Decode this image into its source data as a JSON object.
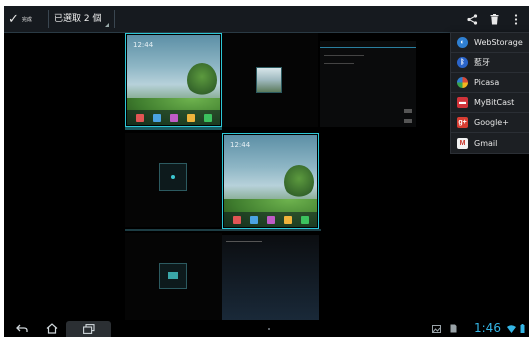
{
  "action_bar": {
    "done_label": "完成",
    "selection_label": "已選取 2 個",
    "share_icon": "share-icon",
    "delete_icon": "trash-icon",
    "overflow_icon": "overflow-menu-icon"
  },
  "share_menu": {
    "items": [
      {
        "label": "WebStorage",
        "icon": "webstorage-icon",
        "color": "#2f7fd1"
      },
      {
        "label": "藍牙",
        "icon": "bluetooth-icon",
        "color": "#2a64c8"
      },
      {
        "label": "Picasa",
        "icon": "picasa-icon",
        "color": "#d64a3a"
      },
      {
        "label": "MyBitCast",
        "icon": "mybitcast-icon",
        "color": "#d1333a"
      },
      {
        "label": "Google+",
        "icon": "google-plus-icon",
        "color": "#d73d32"
      },
      {
        "label": "Gmail",
        "icon": "gmail-icon",
        "color": "#c8372d"
      }
    ]
  },
  "thumbnails": {
    "selected_count": 2,
    "clock_label": "12:44"
  },
  "status_bar": {
    "time": "1:46",
    "back_icon": "back-icon",
    "home_icon": "home-icon",
    "recent_icon": "recent-apps-icon",
    "menu_dot_icon": "menu-dot-icon",
    "gallery_icon": "gallery-notification-icon",
    "sd_icon": "sd-card-icon",
    "wifi_icon": "wifi-icon",
    "battery_icon": "battery-icon"
  },
  "colors": {
    "accent": "#2cc7d6",
    "time_blue": "#34b5e5"
  }
}
